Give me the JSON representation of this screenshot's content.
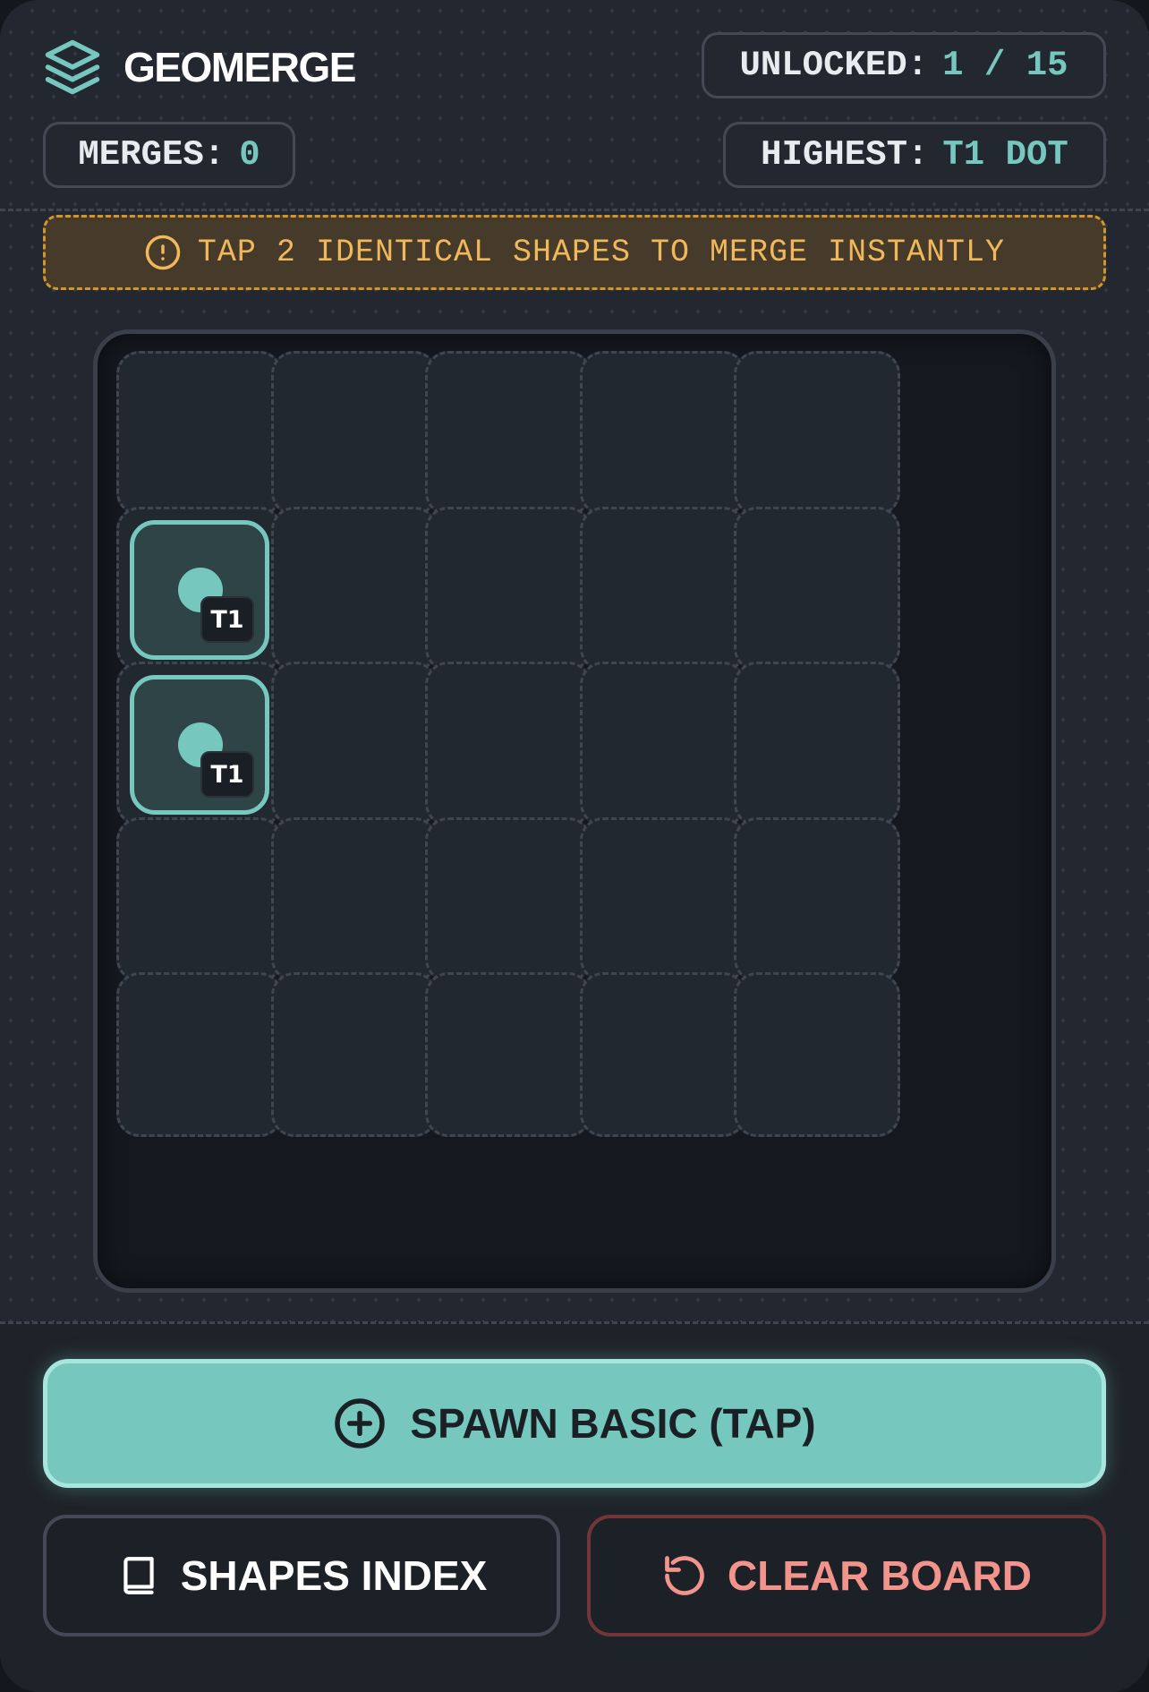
{
  "app": {
    "title": "GEOMERGE",
    "logo_icon": "layers-icon"
  },
  "stats": {
    "unlocked_label": "UNLOCKED:",
    "unlocked_value": "1 / 15",
    "merges_label": "MERGES:",
    "merges_value": "0",
    "highest_label": "HIGHEST:",
    "highest_value": "T1 DOT"
  },
  "hint": {
    "icon": "info-icon",
    "text": "TAP 2 IDENTICAL SHAPES TO MERGE INSTANTLY"
  },
  "board": {
    "rows": 5,
    "cols": 5,
    "pieces": [
      {
        "row": 1,
        "col": 0,
        "shape": "dot",
        "tier": "T1"
      },
      {
        "row": 2,
        "col": 0,
        "shape": "dot",
        "tier": "T1"
      }
    ]
  },
  "actions": {
    "spawn_label": "SPAWN BASIC (TAP)",
    "spawn_icon": "plus-circle-icon",
    "index_label": "SHAPES INDEX",
    "index_icon": "book-icon",
    "clear_label": "CLEAR BOARD",
    "clear_icon": "rotate-ccw-icon"
  },
  "colors": {
    "accent": "#76c8bf",
    "background": "#232830",
    "warning": "#f0b85a",
    "danger": "#f2948c"
  }
}
